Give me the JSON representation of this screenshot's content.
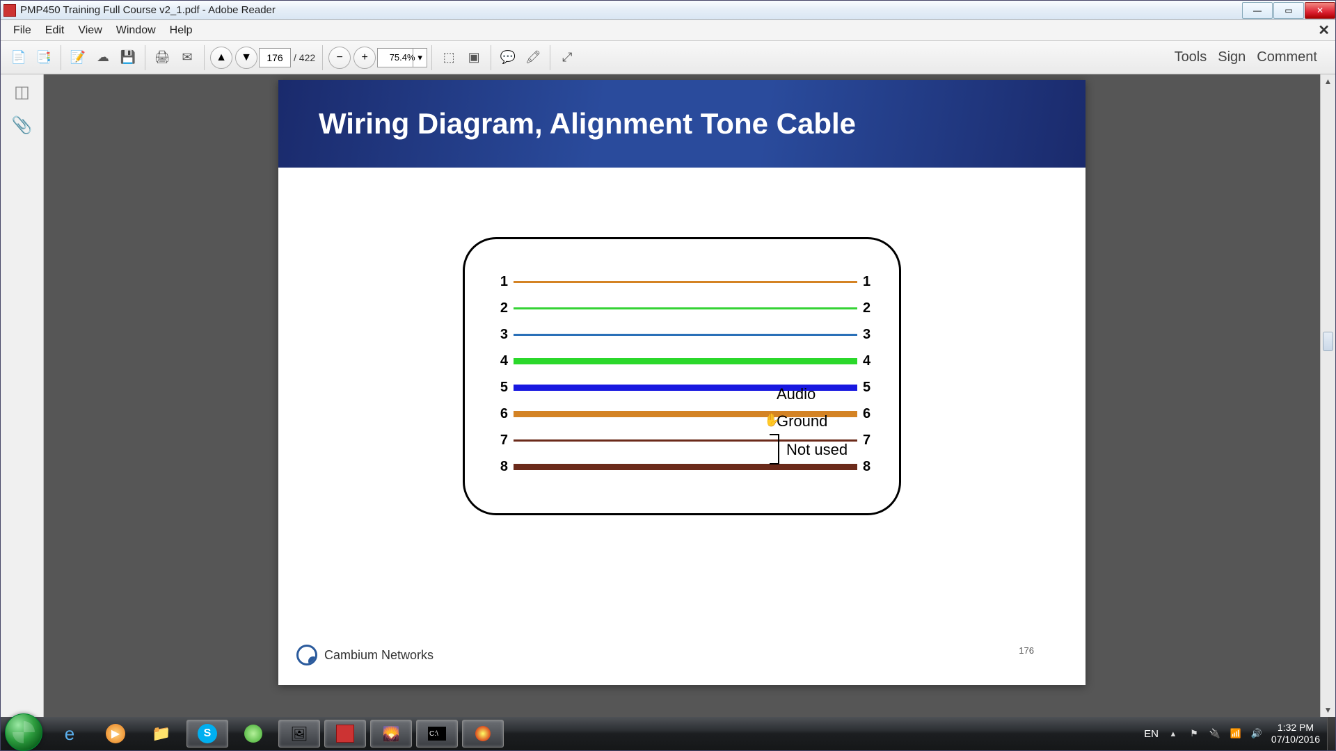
{
  "window": {
    "title": "PMP450 Training Full Course v2_1.pdf - Adobe Reader"
  },
  "menubar": [
    "File",
    "Edit",
    "View",
    "Window",
    "Help"
  ],
  "toolbar": {
    "page_current": "176",
    "page_total": "/  422",
    "zoom": "75.4%"
  },
  "right_links": {
    "tools": "Tools",
    "sign": "Sign",
    "comment": "Comment"
  },
  "slide": {
    "title": "Wiring Diagram, Alignment Tone Cable",
    "footer_logo": "Cambium Networks",
    "page_num": "176",
    "wires": [
      {
        "n": "1",
        "color": "#d48324",
        "thick": false
      },
      {
        "n": "2",
        "color": "#35d335",
        "thick": false
      },
      {
        "n": "3",
        "color": "#2a70b8",
        "thick": false
      },
      {
        "n": "4",
        "color": "#2bd82b",
        "thick": true
      },
      {
        "n": "5",
        "color": "#1818e0",
        "thick": true
      },
      {
        "n": "6",
        "color": "#d48324",
        "thick": true
      },
      {
        "n": "7",
        "color": "#6b2a1a",
        "thick": false
      },
      {
        "n": "8",
        "color": "#6b2a1a",
        "thick": true
      }
    ],
    "labels": {
      "audio": "Audio",
      "ground": "Ground",
      "notused": "Not used"
    }
  },
  "tray": {
    "lang": "EN",
    "time": "1:32 PM",
    "date": "07/10/2016"
  }
}
